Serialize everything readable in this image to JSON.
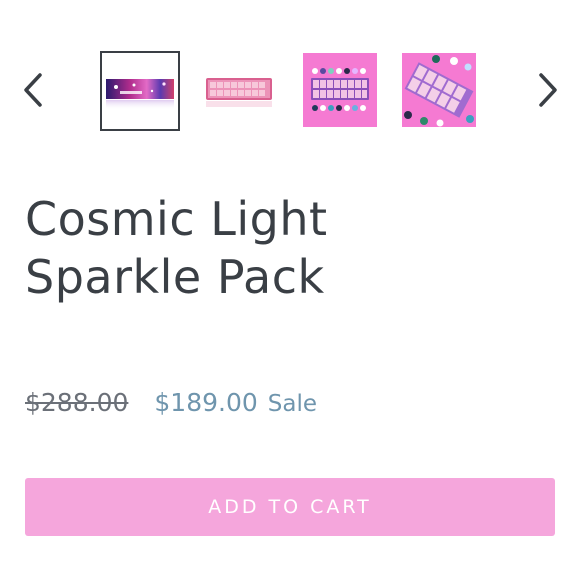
{
  "carousel": {
    "prev_icon": "chevron-left-icon",
    "next_icon": "chevron-right-icon",
    "thumbnails": [
      {
        "name": "galaxy-sparkle-banner",
        "active": true
      },
      {
        "name": "pink-palette-closed",
        "active": false
      },
      {
        "name": "pink-palette-with-pots",
        "active": false
      },
      {
        "name": "pink-palette-angled",
        "active": false
      }
    ]
  },
  "product": {
    "title_line1": "Cosmic Light",
    "title_line2": "Sparkle Pack",
    "compare_price": "$288.00",
    "sale_price": "$189.00",
    "sale_label": "Sale"
  },
  "actions": {
    "add_to_cart_label": "ADD TO CART"
  },
  "colors": {
    "text": "#3a3f45",
    "sale": "#6f95ad",
    "button": "#f5a6dc",
    "thumb_pink": "#f57ad2"
  }
}
